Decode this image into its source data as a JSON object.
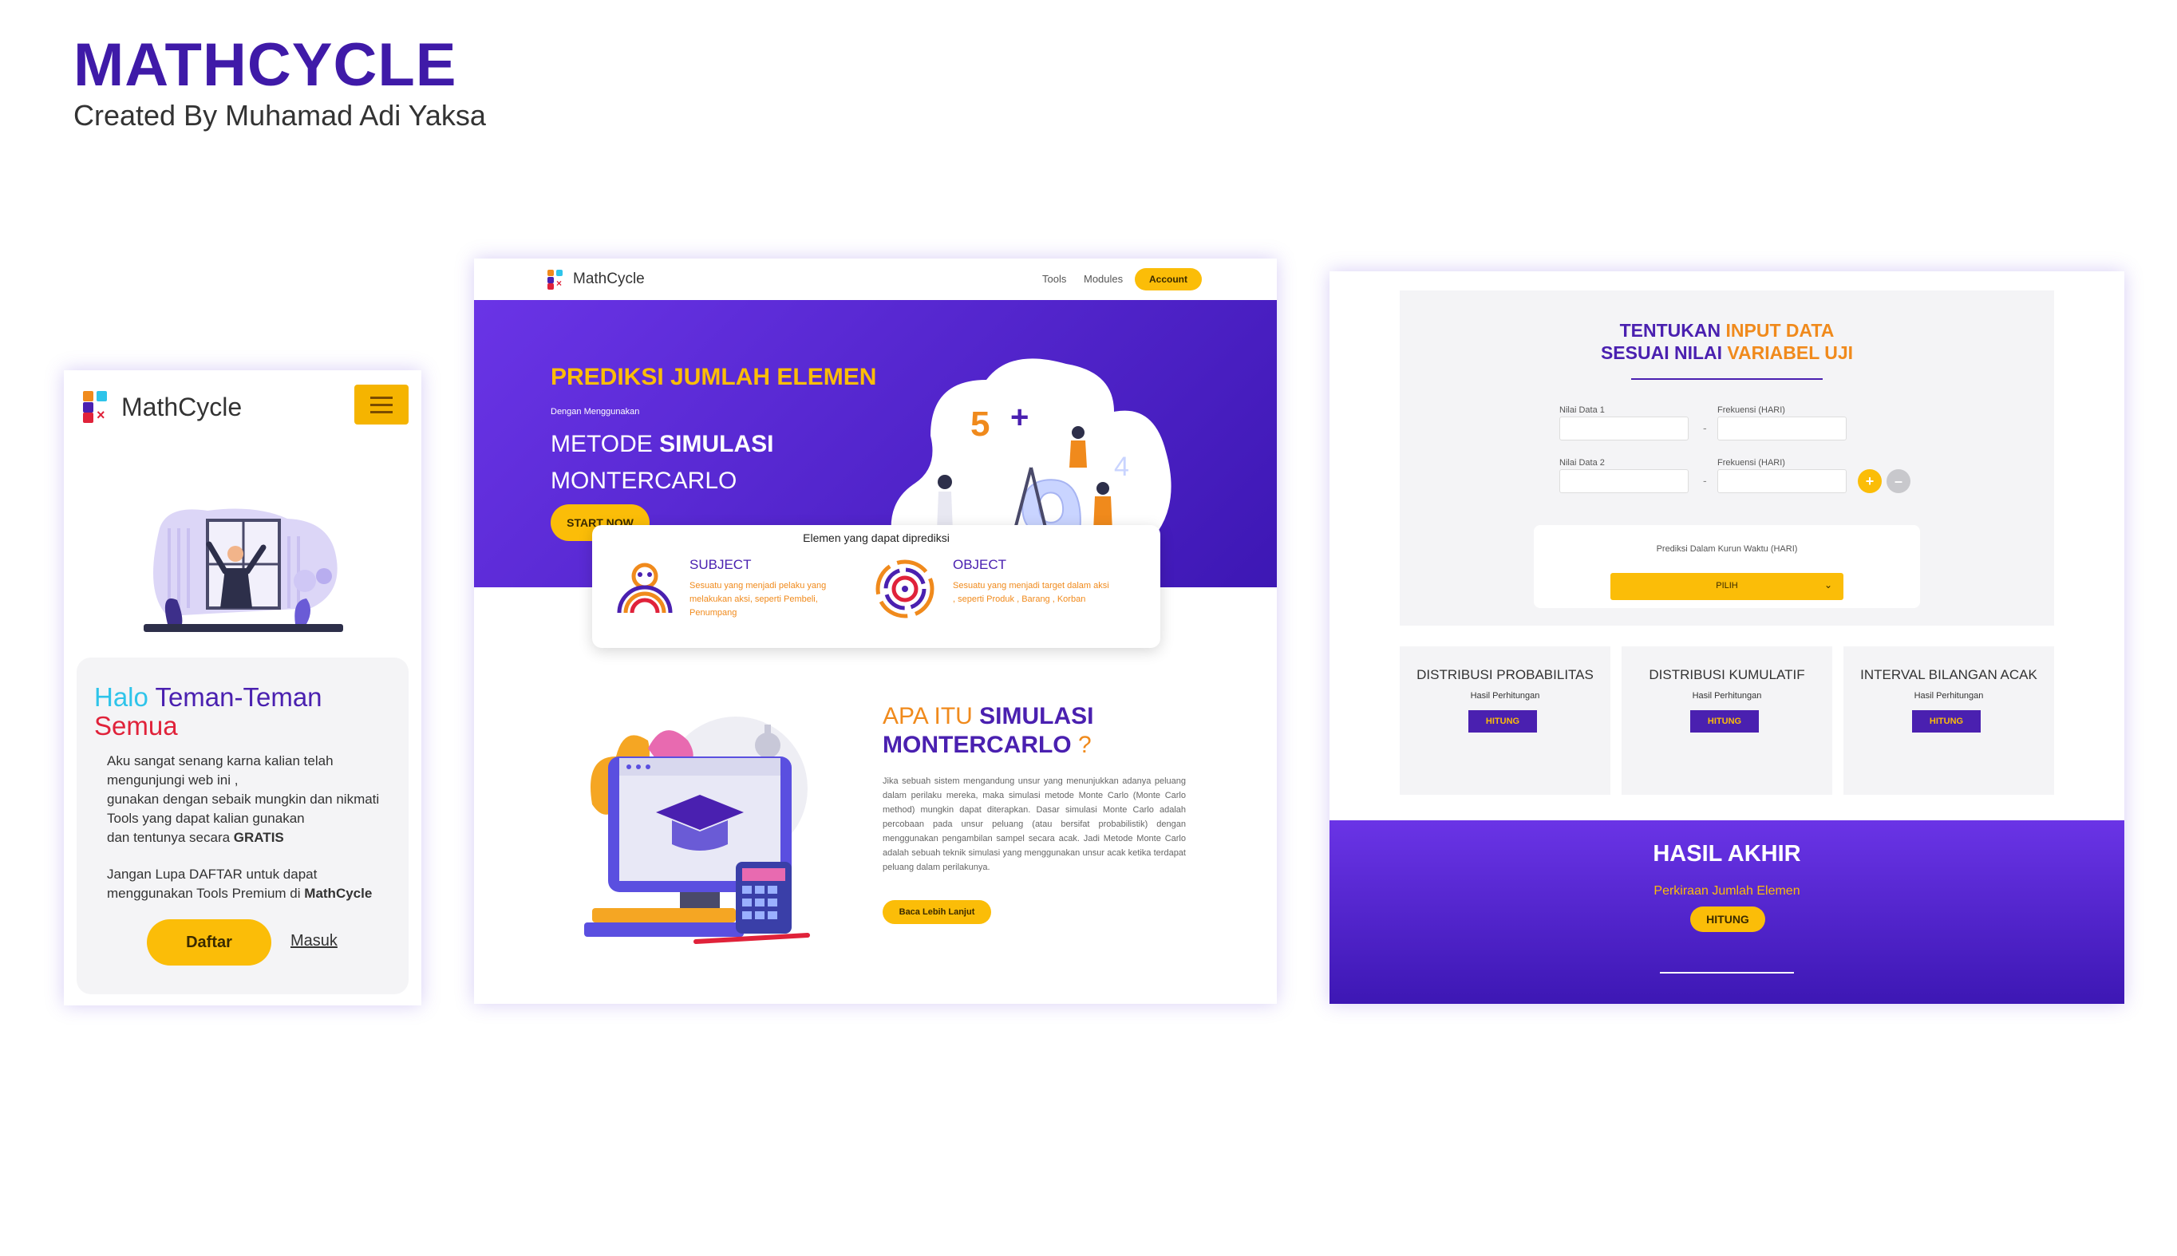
{
  "header": {
    "title": "MATHCYCLE",
    "subtitle": "Created By Muhamad Adi Yaksa"
  },
  "colors": {
    "purple": "#4a20b0",
    "yellow": "#fbbd08",
    "orange": "#f08a1c"
  },
  "mobile": {
    "brand": "MathCycle",
    "greeting": {
      "halo": "Halo",
      "teman": "Teman-Teman",
      "semua": "Semua"
    },
    "body_lines": [
      "Aku sangat senang karna kalian telah",
      "mengunjungi web ini ,",
      "gunakan dengan sebaik mungkin dan nikmati",
      "Tools yang dapat kalian gunakan",
      "dan tentunya secara"
    ],
    "body_gratis": "GRATIS",
    "reminder_lines": [
      "Jangan Lupa DAFTAR untuk dapat",
      "menggunakan Tools Premium di"
    ],
    "reminder_brand": "MathCycle",
    "daftar_label": "Daftar",
    "masuk_label": "Masuk"
  },
  "landing": {
    "brand": "MathCycle",
    "nav": {
      "tools": "Tools",
      "modules": "Modules",
      "account": "Account"
    },
    "hero": {
      "headline": "PREDIKSI JUMLAH ELEMEN",
      "small": "Dengan Menggunakan",
      "metode": "METODE",
      "simulasi": "SIMULASI",
      "montercarlo": "MONTERCARLO",
      "start_label": "START NOW"
    },
    "card": {
      "title": "Elemen yang dapat diprediksi",
      "subject_title": "SUBJECT",
      "subject_text": "Sesuatu yang menjadi pelaku yang melakukan aksi, seperti Pembeli, Penumpang",
      "object_title": "OBJECT",
      "object_text": "Sesuatu yang menjadi target dalam aksi , seperti Produk , Barang , Korban"
    },
    "section2": {
      "apa": "APA ITU",
      "simulasi": "SIMULASI",
      "montercarlo": "MONTERCARLO",
      "qmark": "?",
      "paragraph": "Jika sebuah sistem mengandung unsur yang menunjukkan adanya peluang dalam perilaku mereka, maka simulasi metode Monte Carlo (Monte Carlo method) mungkin dapat diterapkan. Dasar simulasi Monte Carlo adalah percobaan pada unsur peluang (atau bersifat probabilistik) dengan menggunakan pengambilan sampel secara acak. Jadi Metode Monte Carlo adalah sebuah teknik simulasi yang menggunakan unsur acak ketika terdapat peluang dalam perilakunya.",
      "baca_label": "Baca Lebih Lanjut"
    }
  },
  "calculator": {
    "title_a": "TENTUKAN",
    "title_b": "INPUT DATA",
    "title_c": "SESUAI NILAI",
    "title_d": "VARIABEL UJI",
    "rows": [
      {
        "nilai": "Nilai Data 1",
        "frek": "Frekuensi (HARI)"
      },
      {
        "nilai": "Nilai Data 2",
        "frek": "Frekuensi (HARI)"
      }
    ],
    "dash": "-",
    "plus": "+",
    "minus": "–",
    "prediksi_label": "Prediksi Dalam Kurun Waktu (HARI)",
    "pilih_label": "PILIH",
    "chevron": "⌄",
    "boxes": [
      {
        "title": "DISTRIBUSI PROBABILITAS",
        "sub": "Hasil Perhitungan",
        "button": "HITUNG"
      },
      {
        "title": "DISTRIBUSI KUMULATIF",
        "sub": "Hasil Perhitungan",
        "button": "HITUNG"
      },
      {
        "title": "INTERVAL BILANGAN ACAK",
        "sub": "Hasil Perhitungan",
        "button": "HITUNG"
      }
    ],
    "hasil": {
      "title": "HASIL AKHIR",
      "sub": "Perkiraan Jumlah Elemen",
      "button": "HITUNG"
    }
  }
}
